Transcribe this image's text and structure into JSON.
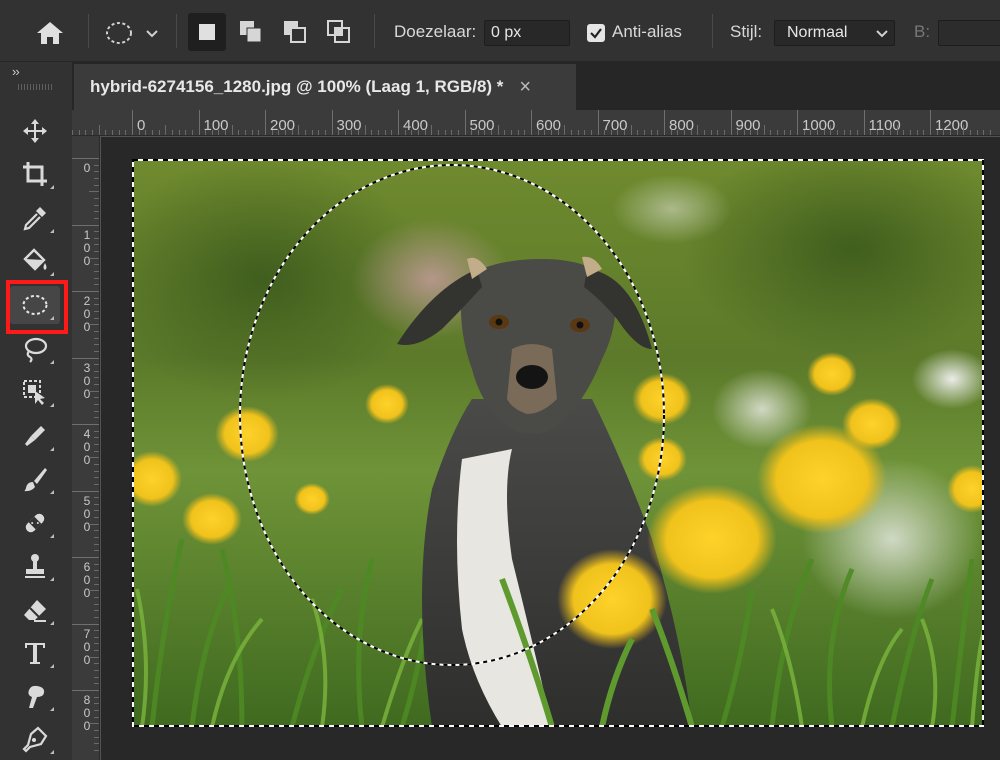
{
  "options_bar": {
    "doezelaar_label": "Doezelaar:",
    "doezelaar_value": "0 px",
    "antialias_label": "Anti-alias",
    "antialias_checked": true,
    "stijl_label": "Stijl:",
    "stijl_value": "Normaal",
    "b_label": "B:"
  },
  "document": {
    "tab_title": "hybrid-6274156_1280.jpg @ 100% (Laag 1, RGB/8) *",
    "close_symbol": "×"
  },
  "ruler_top": [
    "0",
    "100",
    "200",
    "300",
    "400",
    "500",
    "600",
    "700",
    "800",
    "900",
    "1000",
    "1100",
    "1200"
  ],
  "ruler_left": [
    "0",
    "100",
    "200",
    "300",
    "400",
    "500",
    "600",
    "700",
    "800"
  ],
  "toolbar": {
    "collapse": "››",
    "highlighted_tool": "elliptical-marquee-tool"
  },
  "colors": {
    "highlight": "#ff1a1a",
    "panel": "#323232",
    "canvas_bg": "#282828"
  }
}
